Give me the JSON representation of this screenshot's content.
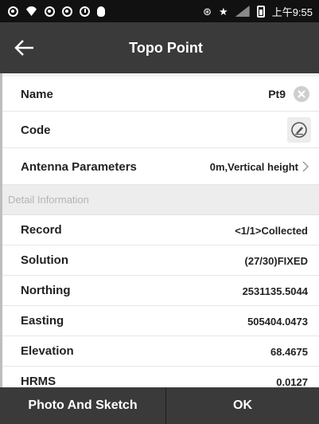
{
  "status_bar": {
    "time": "上午9:55",
    "left_icons": [
      "notification-icon",
      "wifi-question-icon",
      "notification-icon",
      "notification-icon",
      "clock-icon",
      "bug-icon"
    ],
    "right_icons": [
      "bluetooth-icon",
      "star-icon",
      "signal-icon",
      "battery-icon"
    ]
  },
  "header": {
    "title": "Topo Point",
    "back_icon": "arrow-left-icon"
  },
  "form": {
    "name": {
      "label": "Name",
      "value": "Pt9"
    },
    "code": {
      "label": "Code",
      "value": ""
    },
    "antenna": {
      "label": "Antenna Parameters",
      "value": "0m,Vertical height"
    }
  },
  "detail": {
    "section_title": "Detail Information",
    "rows": [
      {
        "label": "Record",
        "value": "<1/1>Collected"
      },
      {
        "label": "Solution",
        "value": "(27/30)FIXED"
      },
      {
        "label": "Northing",
        "value": "2531135.5044"
      },
      {
        "label": "Easting",
        "value": "505404.0473"
      },
      {
        "label": "Elevation",
        "value": "68.4675"
      },
      {
        "label": "HRMS",
        "value": "0.0127"
      }
    ]
  },
  "footer": {
    "photo_label": "Photo And Sketch",
    "ok_label": "OK"
  },
  "colors": {
    "bar_dark": "#3a3a3a",
    "status_bar": "#111111",
    "background": "#f2f2f2",
    "section_text": "#b4b4b4"
  }
}
